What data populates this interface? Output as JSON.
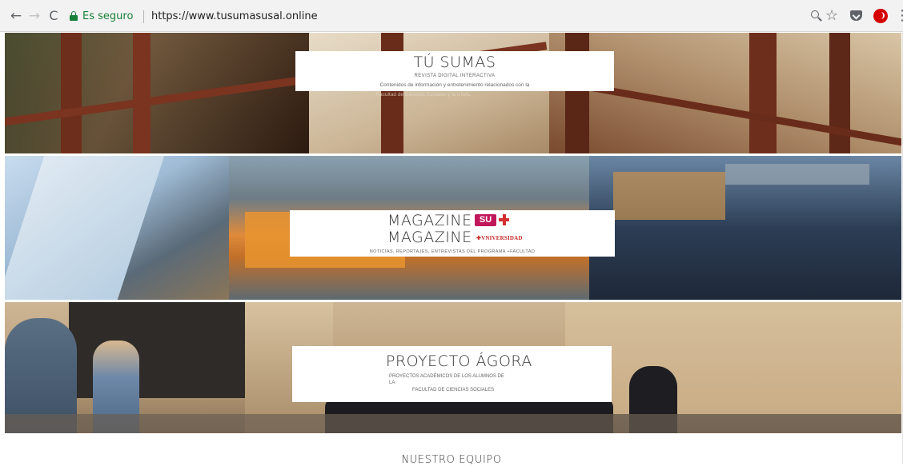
{
  "browser": {
    "nav": {
      "back": "←",
      "forward": "→",
      "reload": "C"
    },
    "secure_label": "Es seguro",
    "url": "https://www.tusumasusal.online",
    "icons": [
      "zoom-icon",
      "star-icon",
      "pocket-icon",
      "extension-icon",
      "menu-icon"
    ],
    "star": "☆",
    "menu": "⋮"
  },
  "sections": {
    "tu_sumas": {
      "title": "TÚ SUMAS",
      "subtitle": "REVISTA DIGITAL INTERACTIVA",
      "description": "Contenidos de información y entretenimiento relacionados con la",
      "description_overflow": "Facultad de Ciencias Sociales y la USAL"
    },
    "magazine": {
      "title_line1": "MAGAZINE",
      "title_line2": "MAGAZINE",
      "su_logo": "SU",
      "univ_logo": "✚VNIVERSIDAD",
      "subtitle": "NOTICIAS, REPORTAJES, ENTREVISTAS DEL PROGRAMA +FACULTAD",
      "accent_colors": [
        "#c1185b",
        "#d32f2f"
      ]
    },
    "agora": {
      "title": "PROYECTO ÁGORA",
      "line1": "PROYECTOS ACADÉMICOS DE LOS ALUMNOS DE",
      "line2": "LA",
      "line3": "FACULTAD DE CIENCIAS SOCIALES"
    }
  },
  "team_heading": "NUESTRO EQUIPO"
}
